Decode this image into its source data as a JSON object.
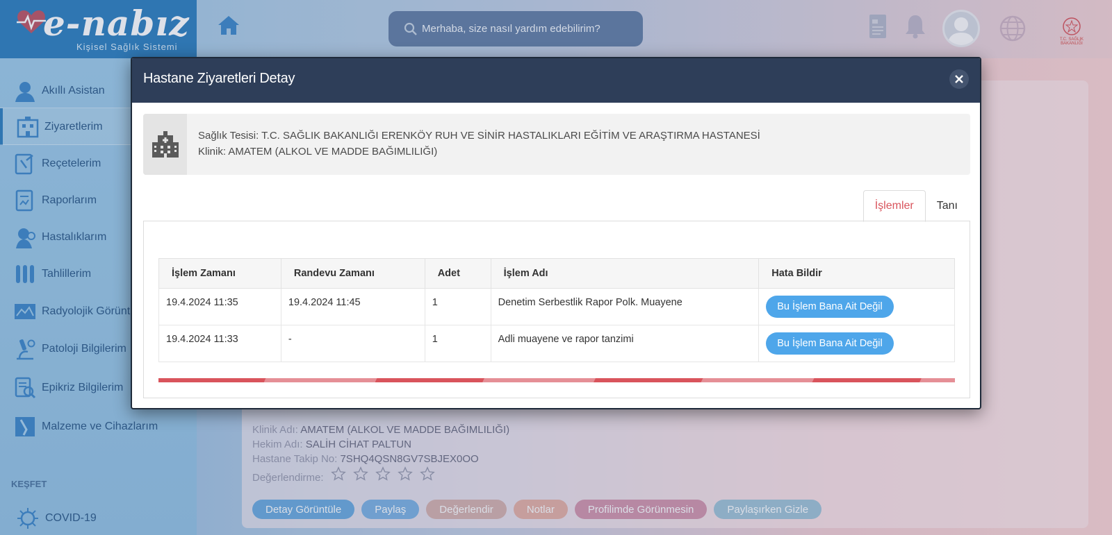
{
  "app": {
    "logo_text": "e-nabız",
    "logo_subtitle": "Kişisel Sağlık Sistemi",
    "search_placeholder": "Merhaba, size nasıl yardım edebilirim?",
    "ministry_label": "T.C. SAĞLIK BAKANLIĞI"
  },
  "sidebar": {
    "items": [
      {
        "label": "Akıllı Asistan",
        "icon": "assistant-icon"
      },
      {
        "label": "Ziyaretlerim",
        "icon": "visits-icon",
        "active": true
      },
      {
        "label": "Reçetelerim",
        "icon": "prescription-icon"
      },
      {
        "label": "Raporlarım",
        "icon": "report-icon"
      },
      {
        "label": "Hastalıklarım",
        "icon": "disease-icon"
      },
      {
        "label": "Tahlillerim",
        "icon": "test-tubes-icon"
      },
      {
        "label": "Radyolojik Görüntü",
        "icon": "radiology-icon"
      },
      {
        "label": "Patoloji Bilgilerim",
        "icon": "microscope-icon"
      },
      {
        "label": "Epikriz Bilgilerim",
        "icon": "epicrisis-icon"
      },
      {
        "label": "Malzeme ve Cihazlarım",
        "icon": "device-icon"
      }
    ],
    "section_label": "KEŞFET",
    "covid_label": "COVID-19"
  },
  "background_visit": {
    "clinic_label": "Klinik Adı:",
    "clinic_value": "AMATEM (ALKOL VE MADDE BAĞIMLILIĞI)",
    "doctor_label": "Hekim Adı:",
    "doctor_value": "SALİH CİHAT PALTUN",
    "tracking_label": "Hastane Takip No:",
    "tracking_value": "7SHQ4QSN8GV7SBJEX0OO",
    "rating_label": "Değerlendirme:",
    "rating_stars": 0,
    "rating_max": 5,
    "actions": [
      {
        "label": "Detay Görüntüle",
        "color": "#5d9fd8"
      },
      {
        "label": "Paylaş",
        "color": "#6ea7dc"
      },
      {
        "label": "Değerlendir",
        "color": "#c7a7a8"
      },
      {
        "label": "Notlar",
        "color": "#d7a59f"
      },
      {
        "label": "Profilimde Görünmesin",
        "color": "#c58aa6"
      },
      {
        "label": "Paylaşırken Gizle",
        "color": "#92b7d0"
      }
    ]
  },
  "modal": {
    "title": "Hastane Ziyaretleri Detay",
    "facility_line": "Sağlık Tesisi: T.C. SAĞLIK BAKANLIĞI ERENKÖY RUH VE SİNİR HASTALIKLARI EĞİTİM VE ARAŞTIRMA HASTANESİ",
    "clinic_line": "Klinik: AMATEM (ALKOL VE MADDE BAĞIMLILIĞI)",
    "tabs": [
      {
        "label": "İşlemler",
        "active": true
      },
      {
        "label": "Tanı",
        "active": false
      }
    ],
    "table": {
      "headers": [
        "İşlem Zamanı",
        "Randevu Zamanı",
        "Adet",
        "İşlem Adı",
        "Hata Bildir"
      ],
      "rows": [
        {
          "islem_zamani": "19.4.2024 11:35",
          "randevu_zamani": "19.4.2024 11:45",
          "adet": "1",
          "islem_adi": "Denetim Serbestlik Rapor Polk. Muayene",
          "button": "Bu İşlem Bana Ait Değil"
        },
        {
          "islem_zamani": "19.4.2024 11:33",
          "randevu_zamani": "-",
          "adet": "1",
          "islem_adi": "Adli muayene ve rapor tanzimi",
          "button": "Bu İşlem Bana Ait Değil"
        }
      ]
    },
    "progress": 1.0,
    "accent_color": "#d9545c",
    "header_color": "#2e3e59",
    "button_color": "#4ea6ea"
  }
}
